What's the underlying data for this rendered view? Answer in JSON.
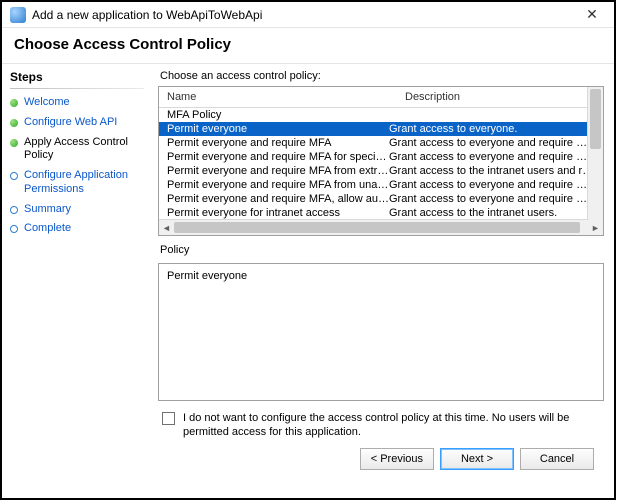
{
  "window": {
    "title": "Add a new application to WebApiToWebApi"
  },
  "header": "Choose Access Control Policy",
  "stepsTitle": "Steps",
  "steps": [
    {
      "label": "Welcome",
      "state": "done"
    },
    {
      "label": "Configure Web API",
      "state": "done"
    },
    {
      "label": "Apply Access Control Policy",
      "state": "done",
      "current": true
    },
    {
      "label": "Configure Application Permissions",
      "state": "pending"
    },
    {
      "label": "Summary",
      "state": "pending"
    },
    {
      "label": "Complete",
      "state": "pending"
    }
  ],
  "listLabel": "Choose an access control policy:",
  "columns": {
    "name": "Name",
    "desc": "Description"
  },
  "policies": [
    {
      "name": "MFA Policy",
      "desc": ""
    },
    {
      "name": "Permit everyone",
      "desc": "Grant access to everyone.",
      "selected": true
    },
    {
      "name": "Permit everyone and require MFA",
      "desc": "Grant access to everyone and require MFA f..."
    },
    {
      "name": "Permit everyone and require MFA for specific group",
      "desc": "Grant access to everyone and require MFA f..."
    },
    {
      "name": "Permit everyone and require MFA from extranet access",
      "desc": "Grant access to the intranet users and requir..."
    },
    {
      "name": "Permit everyone and require MFA from unauthenticated ...",
      "desc": "Grant access to everyone and require MFA f..."
    },
    {
      "name": "Permit everyone and require MFA, allow automatic devi...",
      "desc": "Grant access to everyone and require MFA f..."
    },
    {
      "name": "Permit everyone for intranet access",
      "desc": "Grant access to the intranet users."
    }
  ],
  "policyLabel": "Policy",
  "policyText": "Permit everyone",
  "optOut": "I do not want to configure the access control policy at this time.  No users will be permitted access for this application.",
  "buttons": {
    "prev": "< Previous",
    "next": "Next >",
    "cancel": "Cancel"
  }
}
